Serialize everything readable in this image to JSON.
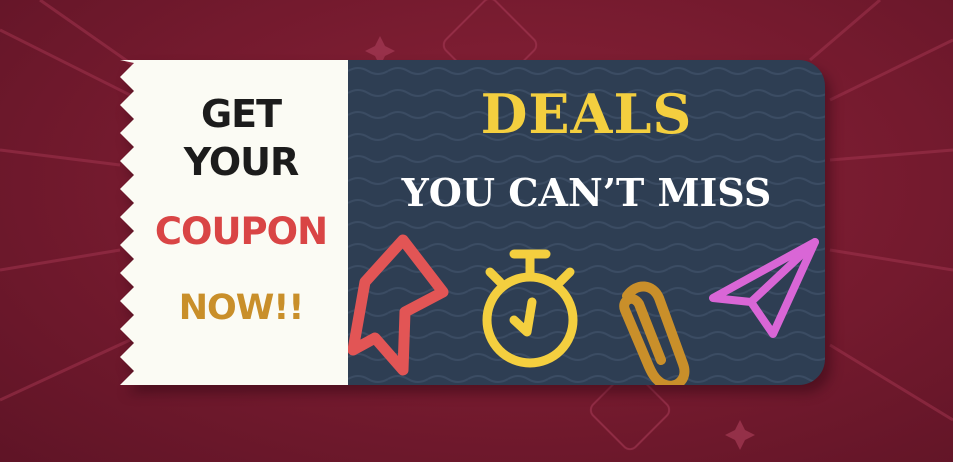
{
  "stub": {
    "line1": "GET",
    "line2": "YOUR",
    "line3": "COUPON",
    "line4": "NOW!!"
  },
  "panel": {
    "headline": "DEALS",
    "subheadline": "YOU CAN’T MISS"
  },
  "icons": [
    "bookmark-icon",
    "stopwatch-icon",
    "paperclip-icon",
    "paper-plane-icon"
  ],
  "colors": {
    "background": "#7a1c30",
    "stub": "#fbfbf4",
    "panel": "#2e3e53",
    "dark_text": "#1c1c1c",
    "coupon_red": "#d94545",
    "now_gold": "#c98f2a",
    "deals_yellow": "#f4cf3f",
    "subheadline_white": "#ffffff",
    "bookmark": "#e25555",
    "stopwatch": "#f4cf3f",
    "paperclip": "#c98f2a",
    "paper_plane": "#d966d6"
  }
}
